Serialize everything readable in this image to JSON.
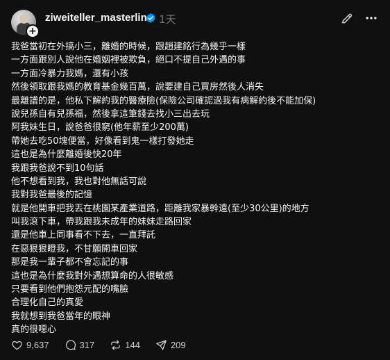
{
  "post": {
    "username": "ziweiteller_masterlin",
    "timestamp": "1天",
    "follow_symbol": "+",
    "lines": [
      "我爸當初在外搞小三，離婚的時候，跟趙建銘行為幾乎一樣",
      "一方面跟別人說他在婚姻裡被欺負，絕口不提自己外遇的事",
      "一方面冷暴力我媽，還有小孩",
      "然後領取跟我媽的教育基金幾百萬，說要建自己買房然後人消失",
      "最離譜的是，他私下解約我的醫療險(保險公司確認過我有病解約後不能加保)",
      "說兒孫自有兒孫福，然後拿這筆錢去找小三出去玩",
      "阿我妹生日，說爸爸很窮(他年薪至少200萬)",
      "帶她去吃50塊便當，好像看到鬼一樣打發她走",
      "這也是為什麼離婚後快20年",
      "我跟我爸說不到10句話",
      "他不想看到我，我也對他無話可說",
      "我對我爸最後的記憶",
      "就是他開車把我丟在桃園某產業道路，距離我家暴幹遠(至少30公里)的地方",
      "叫我滾下車，帶我跟我未成年的妹妹走路回家",
      "還是他車上同事看不下去，一直拜託",
      "在惡狠狠瞪我，不甘願開車回家",
      "那是我一輩子都不會忘記的事",
      "這也是為什麼我對外遇想算命的人很敏感",
      "只要看到他們抱怨元配的嘴臉",
      "合理化自己的真愛",
      "我就想到我爸當年的眼神",
      "真的很噁心"
    ],
    "actions": {
      "likes": "9,637",
      "replies": "317",
      "reposts": "144",
      "shares": "209"
    }
  },
  "colors": {
    "background": "#101010",
    "text_primary": "#f3f5f7",
    "text_secondary": "#777777",
    "verified": "#0095f6"
  },
  "icons": {
    "verified": "verified-badge-icon",
    "edit": "pencil-icon",
    "more": "more-horizontal-icon",
    "like": "heart-icon",
    "reply": "speech-bubble-icon",
    "repost": "repost-icon",
    "share": "send-icon"
  }
}
